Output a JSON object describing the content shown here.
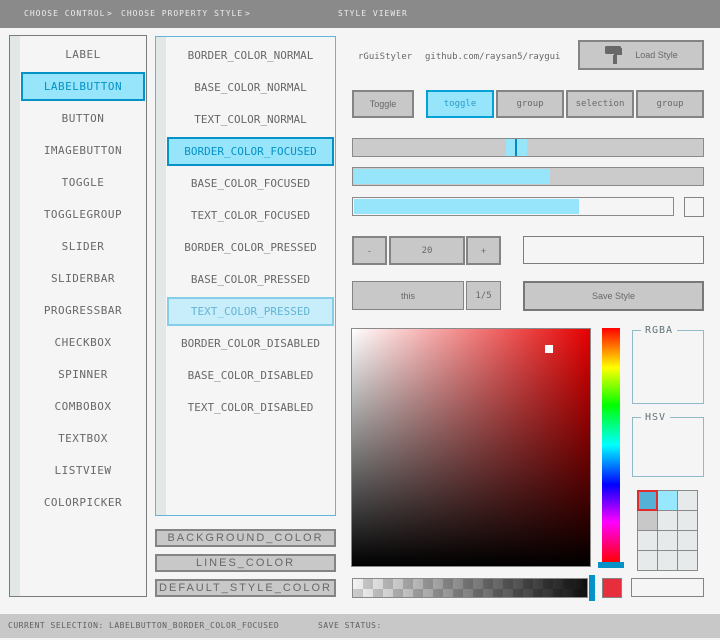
{
  "topbar": {
    "crumb_control": "CHOOSE CONTROL",
    "crumb_property": "CHOOSE PROPERTY STYLE",
    "crumb_viewer": "STYLE VIEWER",
    "separator": ">"
  },
  "controls_list": {
    "items": [
      {
        "label": "LABEL",
        "state": "normal"
      },
      {
        "label": "LABELBUTTON",
        "state": "selected"
      },
      {
        "label": "BUTTON",
        "state": "normal"
      },
      {
        "label": "IMAGEBUTTON",
        "state": "normal"
      },
      {
        "label": "TOGGLE",
        "state": "normal"
      },
      {
        "label": "TOGGLEGROUP",
        "state": "normal"
      },
      {
        "label": "SLIDER",
        "state": "normal"
      },
      {
        "label": "SLIDERBAR",
        "state": "normal"
      },
      {
        "label": "PROGRESSBAR",
        "state": "normal"
      },
      {
        "label": "CHECKBOX",
        "state": "normal"
      },
      {
        "label": "SPINNER",
        "state": "normal"
      },
      {
        "label": "COMBOBOX",
        "state": "normal"
      },
      {
        "label": "TEXTBOX",
        "state": "normal"
      },
      {
        "label": "LISTVIEW",
        "state": "normal"
      },
      {
        "label": "COLORPICKER",
        "state": "normal"
      }
    ]
  },
  "properties_list": {
    "items": [
      {
        "label": "BORDER_COLOR_NORMAL",
        "state": "normal"
      },
      {
        "label": "BASE_COLOR_NORMAL",
        "state": "normal"
      },
      {
        "label": "TEXT_COLOR_NORMAL",
        "state": "normal"
      },
      {
        "label": "BORDER_COLOR_FOCUSED",
        "state": "selected"
      },
      {
        "label": "BASE_COLOR_FOCUSED",
        "state": "normal"
      },
      {
        "label": "TEXT_COLOR_FOCUSED",
        "state": "normal"
      },
      {
        "label": "BORDER_COLOR_PRESSED",
        "state": "normal"
      },
      {
        "label": "BASE_COLOR_PRESSED",
        "state": "normal"
      },
      {
        "label": "TEXT_COLOR_PRESSED",
        "state": "pressed"
      },
      {
        "label": "BORDER_COLOR_DISABLED",
        "state": "normal"
      },
      {
        "label": "BASE_COLOR_DISABLED",
        "state": "normal"
      },
      {
        "label": "TEXT_COLOR_DISABLED",
        "state": "normal"
      }
    ]
  },
  "style_buttons": {
    "background": "BACKGROUND_COLOR",
    "lines": "LINES_COLOR",
    "default": "DEFAULT_STYLE_COLOR"
  },
  "header": {
    "app_name": "rGuiStyler",
    "repo": "github.com/raysan5/raygui",
    "load_button": "Load Style"
  },
  "toggle_row": {
    "single": "Toggle",
    "group": [
      {
        "label": "toggle",
        "state": "selected"
      },
      {
        "label": "group",
        "state": "normal"
      },
      {
        "label": "selection",
        "state": "normal"
      },
      {
        "label": "group",
        "state": "normal"
      }
    ]
  },
  "spinner": {
    "minus": "-",
    "value": "20",
    "plus": "+"
  },
  "textbox": {
    "value": ""
  },
  "combo": {
    "label": "this",
    "counter": "1/5"
  },
  "save_button": "Save Style",
  "group_boxes": {
    "rgba": "RGBA",
    "hsv": "HSV"
  },
  "swatches": {
    "selected_index": 0,
    "cells": [
      "#55b1d5",
      "#97e8ff",
      "#e6eaeb",
      "#c8c8c8",
      "#e6eaeb",
      "#e6eaeb",
      "#e6eaeb",
      "#e6eaeb",
      "#e6eaeb",
      "#e6eaeb",
      "#e6eaeb",
      "#e6eaeb"
    ]
  },
  "hex_box": {
    "value": ""
  },
  "statusbar": {
    "left": "CURRENT SELECTION: LABELBUTTON_BORDER_COLOR_FOCUSED",
    "right": "SAVE STATUS:"
  },
  "colors": {
    "accent": "#0492c7",
    "selection_fill": "#97e5fb",
    "pressed_fill": "#c9eefb",
    "pressed_border": "#86cde8",
    "button_fill": "#c8c8c8",
    "button_border": "#848484",
    "text": "#686868",
    "topbar_bg": "#8a8a8a",
    "statusbar_bg": "#c8c8c8",
    "list_border_focused": "#62b6de",
    "groupbox_border": "#92b9c6",
    "current_color": "#e62e3c"
  }
}
